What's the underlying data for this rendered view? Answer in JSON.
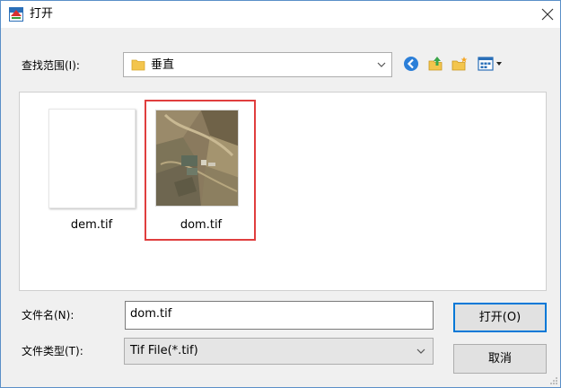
{
  "window": {
    "title": "打开"
  },
  "lookin": {
    "label": "查找范围(I):",
    "value": "垂直"
  },
  "toolbar": {
    "icons": [
      "back-icon",
      "up-folder-icon",
      "new-folder-icon",
      "view-menu-icon"
    ]
  },
  "files": [
    {
      "name": "dem.tif",
      "thumbnail": "blank",
      "selected": false
    },
    {
      "name": "dom.tif",
      "thumbnail": "aerial-photo",
      "selected": true
    }
  ],
  "filename": {
    "label": "文件名(N):",
    "value": "dom.tif"
  },
  "filetype": {
    "label": "文件类型(T):",
    "value": "Tif File(*.tif)"
  },
  "buttons": {
    "open": "打开(O)",
    "cancel": "取消"
  },
  "colors": {
    "highlight": "#e03e3e",
    "accent": "#0078d7",
    "border": "#5a8fc8"
  }
}
